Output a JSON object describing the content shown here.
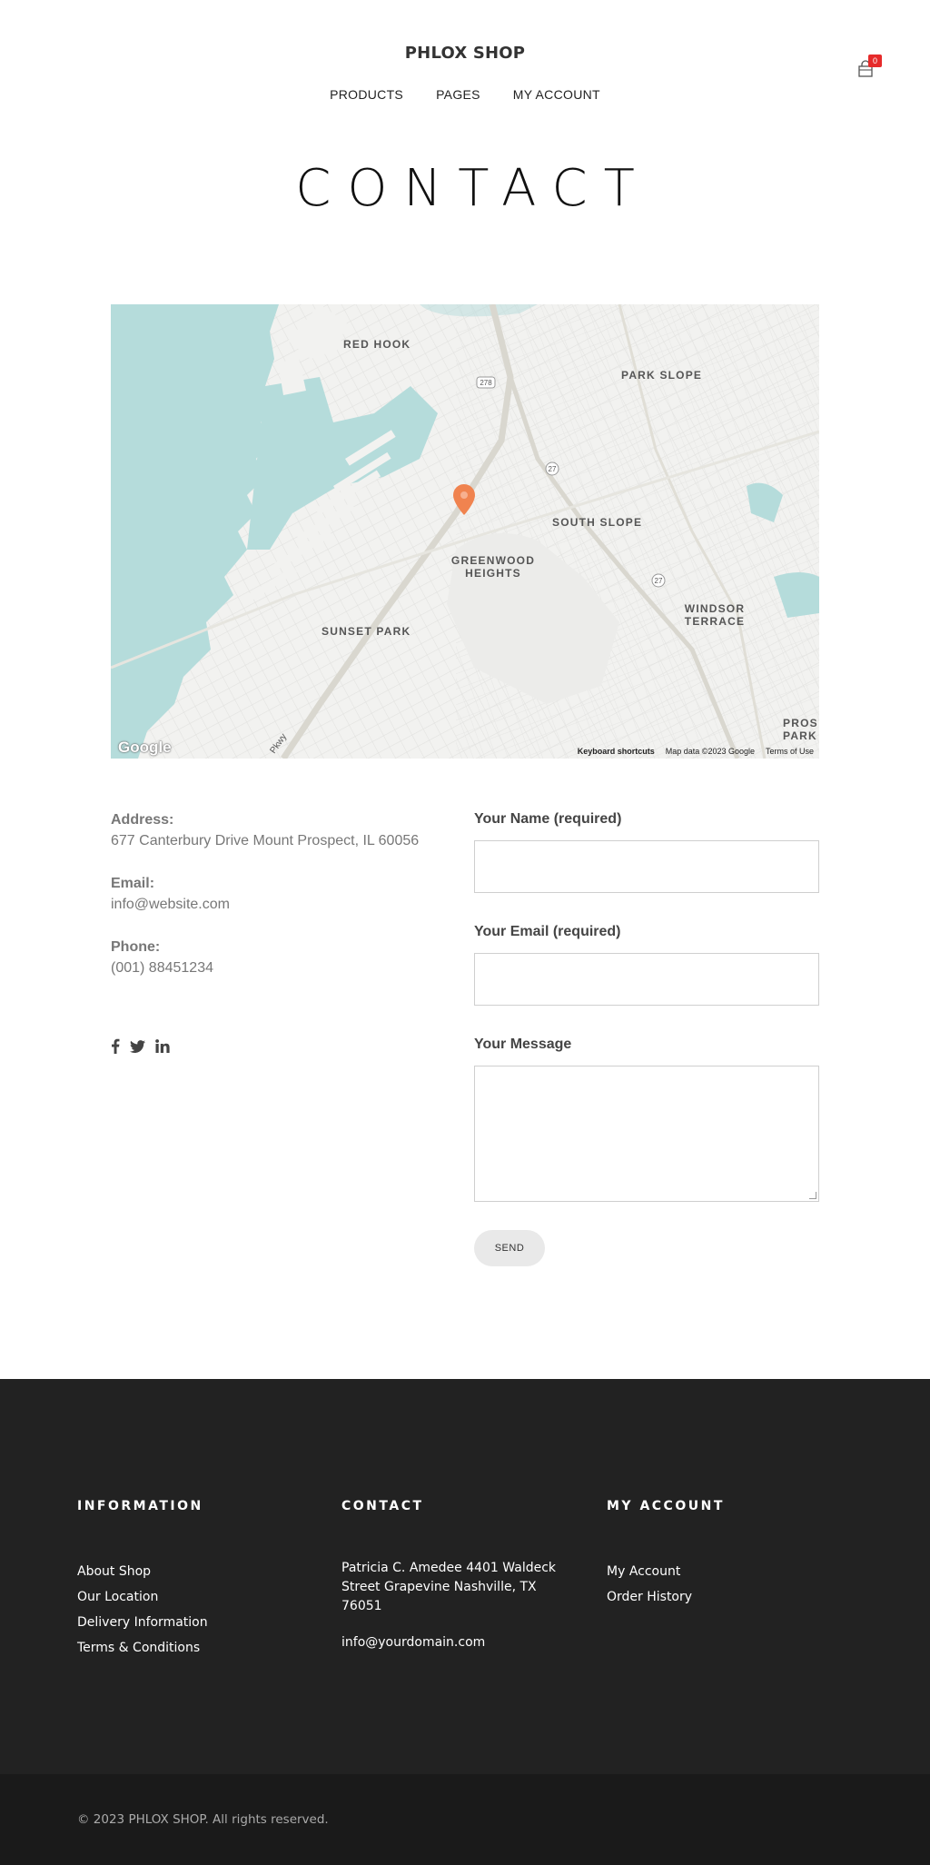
{
  "header": {
    "logo": "PHLOX SHOP",
    "nav": [
      "PRODUCTS",
      "PAGES",
      "MY ACCOUNT"
    ],
    "cart_count": "0",
    "cart_icon": "shopping-bag-icon"
  },
  "page_title": "CONTACT",
  "map": {
    "labels": [
      "RED HOOK",
      "PARK SLOPE",
      "SOUTH SLOPE",
      "GREENWOOD HEIGHTS",
      "SUNSET PARK",
      "WINDSOR TERRACE",
      "PROS PARK"
    ],
    "shields": [
      "278",
      "27",
      "27"
    ],
    "road_label": "Pkwy",
    "logo": "Google",
    "footer": {
      "keyboard": "Keyboard shortcuts",
      "data": "Map data ©2023 Google",
      "terms": "Terms of Use"
    },
    "colors": {
      "water": "#b5dcdb",
      "land": "#f2f2f0",
      "marker": "#f0834f"
    }
  },
  "contact_info": {
    "address_label": "Address:",
    "address": "677 Canterbury Drive Mount Prospect, IL 60056",
    "email_label": "Email:",
    "email": "info@website.com",
    "phone_label": "Phone:",
    "phone": "(001) 88451234",
    "social": [
      "facebook-icon",
      "twitter-icon",
      "linkedin-icon"
    ]
  },
  "form": {
    "name_label": "Your Name (required)",
    "email_label": "Your Email (required)",
    "message_label": "Your Message",
    "send_label": "SEND"
  },
  "footer": {
    "information": {
      "heading": "INFORMATION",
      "links": [
        "About Shop",
        "Our Location",
        "Delivery Information",
        "Terms & Conditions"
      ]
    },
    "contact": {
      "heading": "CONTACT",
      "address": "Patricia C. Amedee 4401 Waldeck Street Grapevine Nashville, TX 76051",
      "email": "info@yourdomain.com"
    },
    "account": {
      "heading": "MY ACCOUNT",
      "links": [
        "My Account",
        "Order History"
      ]
    },
    "copyright": "© 2023 PHLOX SHOP. All rights reserved.",
    "colors": {
      "footer_bg": "#222222",
      "bottom_bg": "#1a1a1a"
    }
  }
}
